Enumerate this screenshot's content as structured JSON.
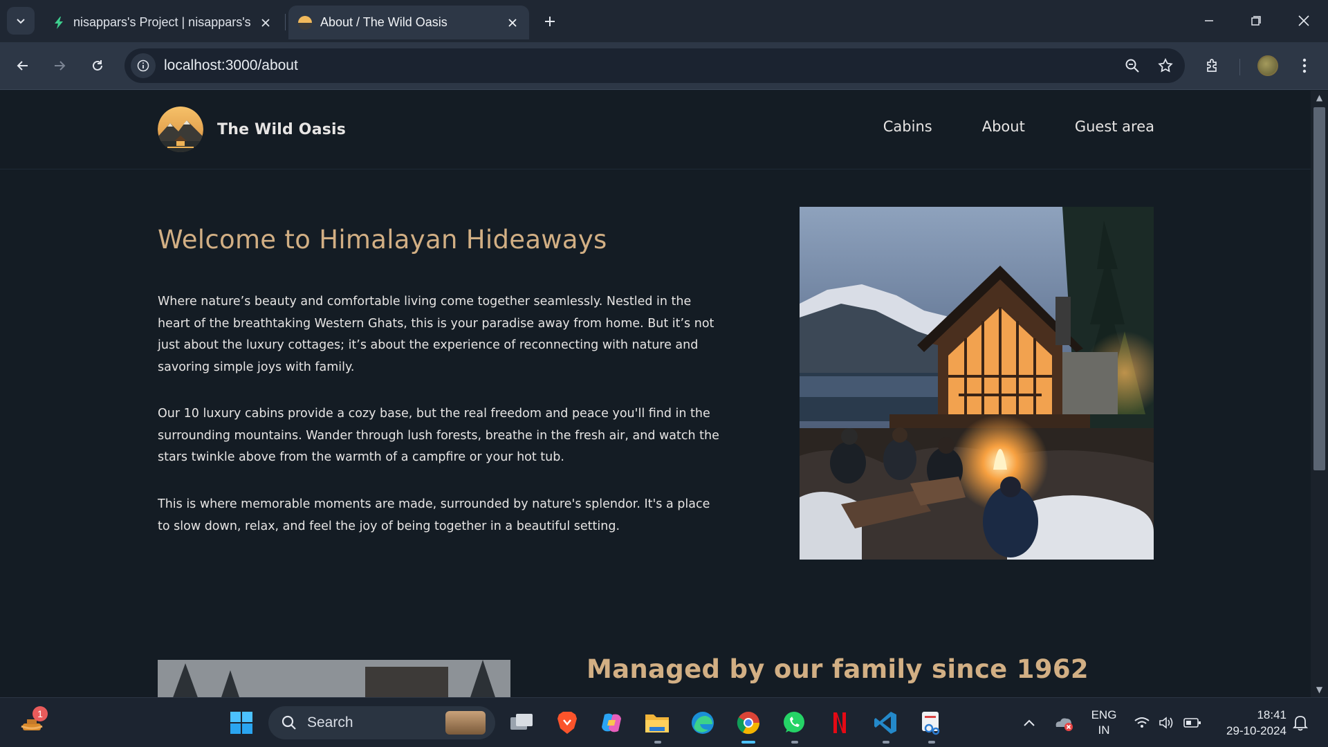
{
  "browser": {
    "tabs": [
      {
        "title": "nisappars's Project | nisappars's",
        "active": false
      },
      {
        "title": "About / The Wild Oasis",
        "active": true
      }
    ],
    "url": "localhost:3000/about"
  },
  "site": {
    "logo_text": "The Wild Oasis",
    "nav": [
      "Cabins",
      "About",
      "Guest area"
    ]
  },
  "about": {
    "title": "Welcome to Himalayan Hideaways",
    "paragraphs": [
      "Where nature’s beauty and comfortable living come together seamlessly. Nestled in the heart of the breathtaking Western Ghats, this is your paradise away from home. But it’s not just about the luxury cottages; it’s about the experience of reconnecting with nature and savoring simple joys with family.",
      "Our 10 luxury cabins provide a cozy base, but the real freedom and peace you'll find in the surrounding mountains. Wander through lush forests, breathe in the fresh air, and watch the stars twinkle above from the warmth of a campfire or your hot tub.",
      "This is where memorable moments are made, surrounded by nature's splendor. It's a place to slow down, relax, and feel the joy of being together in a beautiful setting."
    ],
    "section2_title": "Managed by our family since 1962"
  },
  "taskbar": {
    "search_label": "Search",
    "notification_count": "1",
    "language": "ENG",
    "region": "IN",
    "time": "18:41",
    "date": "29-10-2024"
  },
  "colors": {
    "accent": "#d2af84",
    "page_bg": "#141c24",
    "text": "#e7e5e4"
  }
}
